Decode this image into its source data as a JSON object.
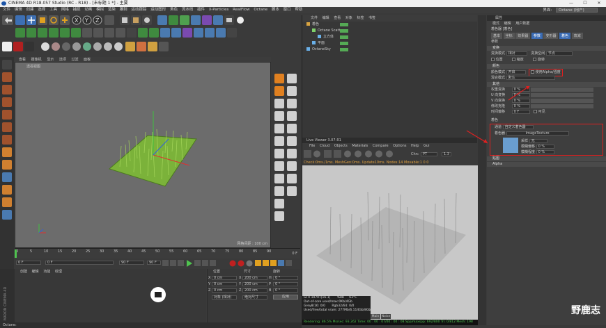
{
  "window": {
    "title": "CINEMA 4D R18.057 Studio (RC - R18) - [未标题 1 *] - 主要",
    "minimize": "—",
    "maximize": "☐",
    "close": "✕"
  },
  "menubar": {
    "items": [
      "文件",
      "编辑",
      "创建",
      "选择",
      "工具",
      "网格",
      "捕捉",
      "动画",
      "模拟",
      "渲染",
      "雕刻",
      "运动跟踪",
      "运动图形",
      "角色",
      "流水线",
      "插件",
      "X-Particles",
      "RealFlow",
      "Octane",
      "脚本",
      "窗口",
      "帮助"
    ],
    "layout_label": "界面:",
    "layout_value": "Octane (用户)"
  },
  "viewport": {
    "menu": [
      "查看",
      "摄像机",
      "显示",
      "选项",
      "过滤",
      "面板"
    ],
    "label": "透视视图",
    "grid_info": "网格间距 : 100 cm"
  },
  "timeline": {
    "ticks": [
      "0",
      "5",
      "10",
      "15",
      "20",
      "25",
      "30",
      "35",
      "40",
      "45",
      "50",
      "55",
      "60",
      "65",
      "70",
      "75",
      "80",
      "85",
      "90"
    ],
    "end_frame": "0 F",
    "current_frame": "0 F",
    "start_field": "0 F",
    "end_field": "90 F",
    "end_field2": "90 F"
  },
  "materials": {
    "menu": [
      "创建",
      "编辑",
      "功能",
      "纹理"
    ]
  },
  "coordinates": {
    "headers": [
      "位置",
      "尺寸",
      "旋转"
    ],
    "rows": [
      {
        "axis": "X",
        "pos": "0 cm",
        "size_axis": "X",
        "size": "200 cm",
        "rot_axis": "H",
        "rot": "0 °"
      },
      {
        "axis": "Y",
        "pos": "0 cm",
        "size_axis": "Y",
        "size": "200 cm",
        "rot_axis": "P",
        "rot": "0 °"
      },
      {
        "axis": "Z",
        "pos": "0 cm",
        "size_axis": "Z",
        "size": "200 cm",
        "rot_axis": "B",
        "rot": "0 °"
      }
    ],
    "mode_object": "对象 (相对)",
    "mode_size": "绝对尺寸",
    "apply": "应用"
  },
  "object_manager": {
    "menu": [
      "文件",
      "编辑",
      "查看",
      "对象",
      "标签",
      "书签"
    ],
    "items": [
      {
        "name": "着色",
        "indent": 0,
        "color": "#d9a441"
      },
      {
        "name": "Octane Scatter",
        "indent": 1,
        "color": "#7fd06a"
      },
      {
        "name": "立方体",
        "indent": 2,
        "color": "#6ab0e8"
      },
      {
        "name": "平面",
        "indent": 1,
        "color": "#6ab0e8"
      },
      {
        "name": "OctaneSky",
        "indent": 0,
        "color": "#6ab0e8"
      }
    ]
  },
  "live_viewer": {
    "title": "Live Viewer 3.07-R1",
    "menu": [
      "File",
      "Cloud",
      "Objects",
      "Materials",
      "Compare",
      "Options",
      "Help",
      "Gui"
    ],
    "chn_label": "Chn:",
    "chn_value": "PT",
    "zoom": "1.3",
    "status": "Check:0ms./1ms. MeshGen:0ms. Update10ms. Nodes:14 Movable:1  0 0",
    "gpu": [
      "GTX 1070T[16.1]",
      "%88",
      "63°C"
    ],
    "mem": [
      "Out-of-core used/max:0Kb/4Gb",
      "Grey8/16: 0/0",
      "Rgb32/64: 0/0",
      "Used/free/total vram: 277Mb/6.114Gb/8Gb"
    ],
    "tabs": [
      "Main",
      "Noise"
    ],
    "footer": "Rendering: 86.5%  Ms/sec: 93.262  Time: 00 : 00 : 07/00 : 00 : 08  Spp/maxspp: 692/800  Tri: 0/812  Mesh: 198"
  },
  "attributes": {
    "title": "属性",
    "menu": [
      "模式",
      "编辑",
      "用户数据"
    ],
    "object_name": "着色器 [着色]",
    "tabs": [
      "基本",
      "坐标",
      "效果器",
      "参数",
      "变形器",
      "着色",
      "衰减"
    ],
    "params_header": "参数",
    "transform": {
      "label": "变换",
      "mode_label": "变换模式",
      "mode_value": "相对",
      "space_label": "变换空间",
      "space_value": "节点",
      "checks": [
        "位置",
        "缩放",
        "旋转"
      ]
    },
    "color_section": {
      "label": "颜色",
      "mode_label": "颜色模式",
      "mode_value": "开启",
      "alpha_label": "使用Alpha/强度",
      "blend_label": "混合模式",
      "blend_value": "默认"
    },
    "other": {
      "label": "其他",
      "rows": [
        {
          "label": "权重变换",
          "value": "0 %"
        },
        {
          "label": "U 向变换",
          "value": "0 %"
        },
        {
          "label": "V 向变换",
          "value": "0 %"
        },
        {
          "label": "修改克隆",
          "value": "0 %"
        },
        {
          "label": "时间偏移",
          "value": "0 F"
        }
      ],
      "visible_label": "可见"
    },
    "shading": {
      "header": "着色",
      "channel_label": "通道",
      "channel_value": "自定义着色器",
      "shader_label": "着色器",
      "shader_value": "ImageTexture",
      "sample_label": "采样",
      "sample_value": "无",
      "blur_offset_label": "模糊偏移",
      "blur_offset_value": "0 %",
      "blur_scale_label": "模糊程度",
      "blur_scale_value": "0 %"
    },
    "collapsed": [
      "贴图",
      "Alpha"
    ]
  },
  "statusbar": "Octane:",
  "watermark": "野鹿志",
  "brand": "MAXON CINEMA 4D"
}
